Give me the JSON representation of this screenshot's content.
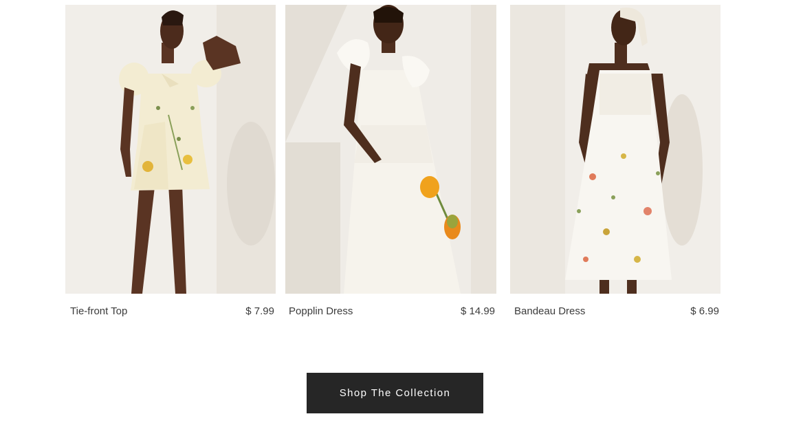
{
  "products": [
    {
      "name": "Tie-front Top",
      "price": "$ 7.99",
      "image": "model-in-floral-mini-dress"
    },
    {
      "name": "Popplin Dress",
      "price": "$ 14.99",
      "image": "model-in-white-ruffle-dress-with-flower"
    },
    {
      "name": "Bandeau Dress",
      "price": "$ 6.99",
      "image": "model-in-floral-bandeau-midi-dress"
    }
  ],
  "cta": {
    "label": "Shop The Collection"
  },
  "colors": {
    "button_bg": "#262626",
    "button_text": "#ffffff",
    "text": "#3b3b3b"
  }
}
